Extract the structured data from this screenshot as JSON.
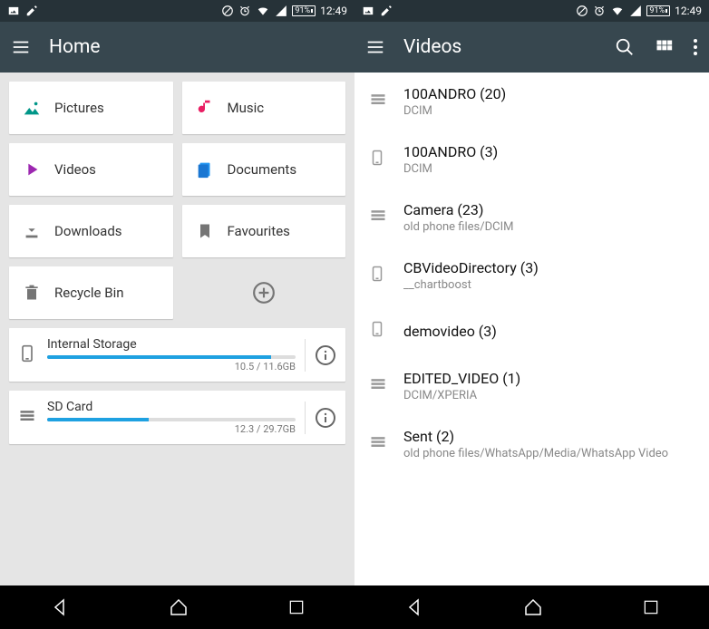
{
  "statusbar": {
    "battery": "91%",
    "time": "12:49"
  },
  "left": {
    "title": "Home",
    "tiles": {
      "pictures": "Pictures",
      "music": "Music",
      "videos": "Videos",
      "documents": "Documents",
      "downloads": "Downloads",
      "favourites": "Favourites",
      "recycle": "Recycle Bin"
    },
    "storage": [
      {
        "name": "Internal Storage",
        "usage": "10.5 / 11.6GB",
        "pct": 90
      },
      {
        "name": "SD Card",
        "usage": "12.3 / 29.7GB",
        "pct": 41
      }
    ]
  },
  "right": {
    "title": "Videos",
    "items": [
      {
        "icon": "storage",
        "primary": "100ANDRO (20)",
        "secondary": "DCIM"
      },
      {
        "icon": "phone",
        "primary": "100ANDRO (3)",
        "secondary": "DCIM"
      },
      {
        "icon": "storage",
        "primary": "Camera (23)",
        "secondary": "old phone files/DCIM"
      },
      {
        "icon": "phone",
        "primary": "CBVideoDirectory (3)",
        "secondary": "__chartboost"
      },
      {
        "icon": "phone",
        "primary": "demovideo (3)",
        "secondary": ""
      },
      {
        "icon": "storage",
        "primary": "EDITED_VIDEO (1)",
        "secondary": "DCIM/XPERIA"
      },
      {
        "icon": "storage",
        "primary": "Sent (2)",
        "secondary": "old phone files/WhatsApp/Media/WhatsApp Video"
      }
    ]
  }
}
